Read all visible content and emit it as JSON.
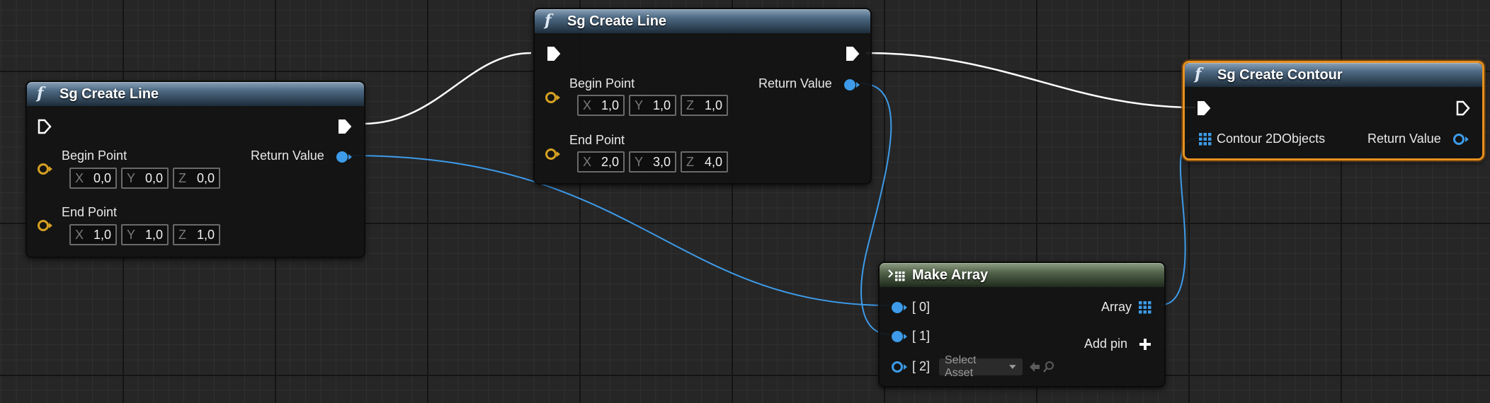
{
  "nodes": {
    "line1": {
      "title": "Sg Create Line",
      "fn_glyph": "f",
      "begin_label": "Begin Point",
      "end_label": "End Point",
      "return_label": "Return Value",
      "begin": {
        "x": {
          "axis": "X",
          "value": "0,0"
        },
        "y": {
          "axis": "Y",
          "value": "0,0"
        },
        "z": {
          "axis": "Z",
          "value": "0,0"
        }
      },
      "end": {
        "x": {
          "axis": "X",
          "value": "1,0"
        },
        "y": {
          "axis": "Y",
          "value": "1,0"
        },
        "z": {
          "axis": "Z",
          "value": "1,0"
        }
      }
    },
    "line2": {
      "title": "Sg Create Line",
      "fn_glyph": "f",
      "begin_label": "Begin Point",
      "end_label": "End Point",
      "return_label": "Return Value",
      "begin": {
        "x": {
          "axis": "X",
          "value": "1,0"
        },
        "y": {
          "axis": "Y",
          "value": "1,0"
        },
        "z": {
          "axis": "Z",
          "value": "1,0"
        }
      },
      "end": {
        "x": {
          "axis": "X",
          "value": "2,0"
        },
        "y": {
          "axis": "Y",
          "value": "3,0"
        },
        "z": {
          "axis": "Z",
          "value": "4,0"
        }
      }
    },
    "contour": {
      "title": "Sg Create Contour",
      "fn_glyph": "f",
      "input_label": "Contour 2DObjects",
      "return_label": "Return Value"
    },
    "make_array": {
      "title": "Make Array",
      "pins": [
        "[ 0]",
        "[ 1]",
        "[ 2]"
      ],
      "array_label": "Array",
      "add_pin_label": "Add pin",
      "select_asset": "Select Asset"
    }
  },
  "colors": {
    "exec_wire": "#ffffff",
    "object_pin": "#3d9be9",
    "struct_pin": "#d6a022",
    "selection": "#e7901e"
  },
  "icons": [
    "function-icon",
    "exec-pin-icon",
    "struct-pin-icon",
    "object-pin-icon",
    "array-grid-icon",
    "make-array-icon",
    "plus-icon",
    "arrow-left-icon",
    "search-icon",
    "chevron-down-icon"
  ]
}
